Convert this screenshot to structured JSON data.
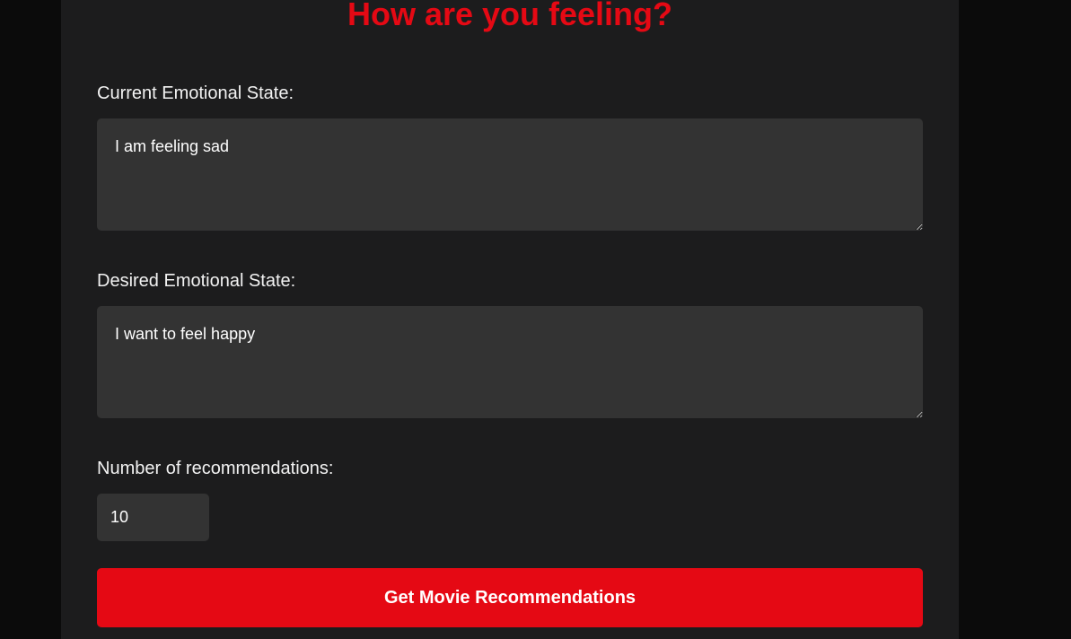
{
  "form": {
    "title": "How are you feeling?",
    "current_state": {
      "label": "Current Emotional State:",
      "value": "I am feeling sad"
    },
    "desired_state": {
      "label": "Desired Emotional State:",
      "value": "I want to feel happy"
    },
    "recommendations": {
      "label": "Number of recommendations:",
      "value": "10"
    },
    "submit_label": "Get Movie Recommendations"
  },
  "colors": {
    "accent": "#e50914",
    "background": "#0b0b0b",
    "card": "#1c1c1d",
    "input": "#333333",
    "text": "#f2f2f2"
  }
}
